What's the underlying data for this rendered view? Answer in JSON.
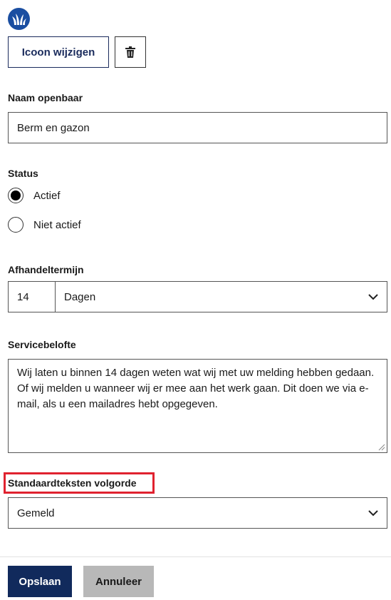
{
  "icon": {
    "name": "grass-icon",
    "brand_color": "#1a4ea1"
  },
  "icon_controls": {
    "change_label": "Icoon wijzigen",
    "delete_icon": "trash-icon"
  },
  "public_name": {
    "label": "Naam openbaar",
    "value": "Berm en gazon"
  },
  "status": {
    "label": "Status",
    "options": [
      {
        "label": "Actief",
        "selected": true
      },
      {
        "label": "Niet actief",
        "selected": false
      }
    ]
  },
  "handling_term": {
    "label": "Afhandeltermijn",
    "amount": "14",
    "unit": "Dagen"
  },
  "service_promise": {
    "label": "Servicebelofte",
    "value": "Wij laten u binnen 14 dagen weten wat wij met uw melding hebben gedaan. Of wij melden u wanneer wij er mee aan het werk gaan. Dit doen we via e-mail, als u een mailadres hebt opgegeven."
  },
  "standard_texts_order": {
    "label": "Standaardteksten volgorde",
    "value": "Gemeld"
  },
  "footer": {
    "save_label": "Opslaan",
    "cancel_label": "Annuleer"
  },
  "colors": {
    "primary": "#112a5c",
    "highlight": "#e0222f",
    "secondary_button": "#b8b8b8"
  }
}
